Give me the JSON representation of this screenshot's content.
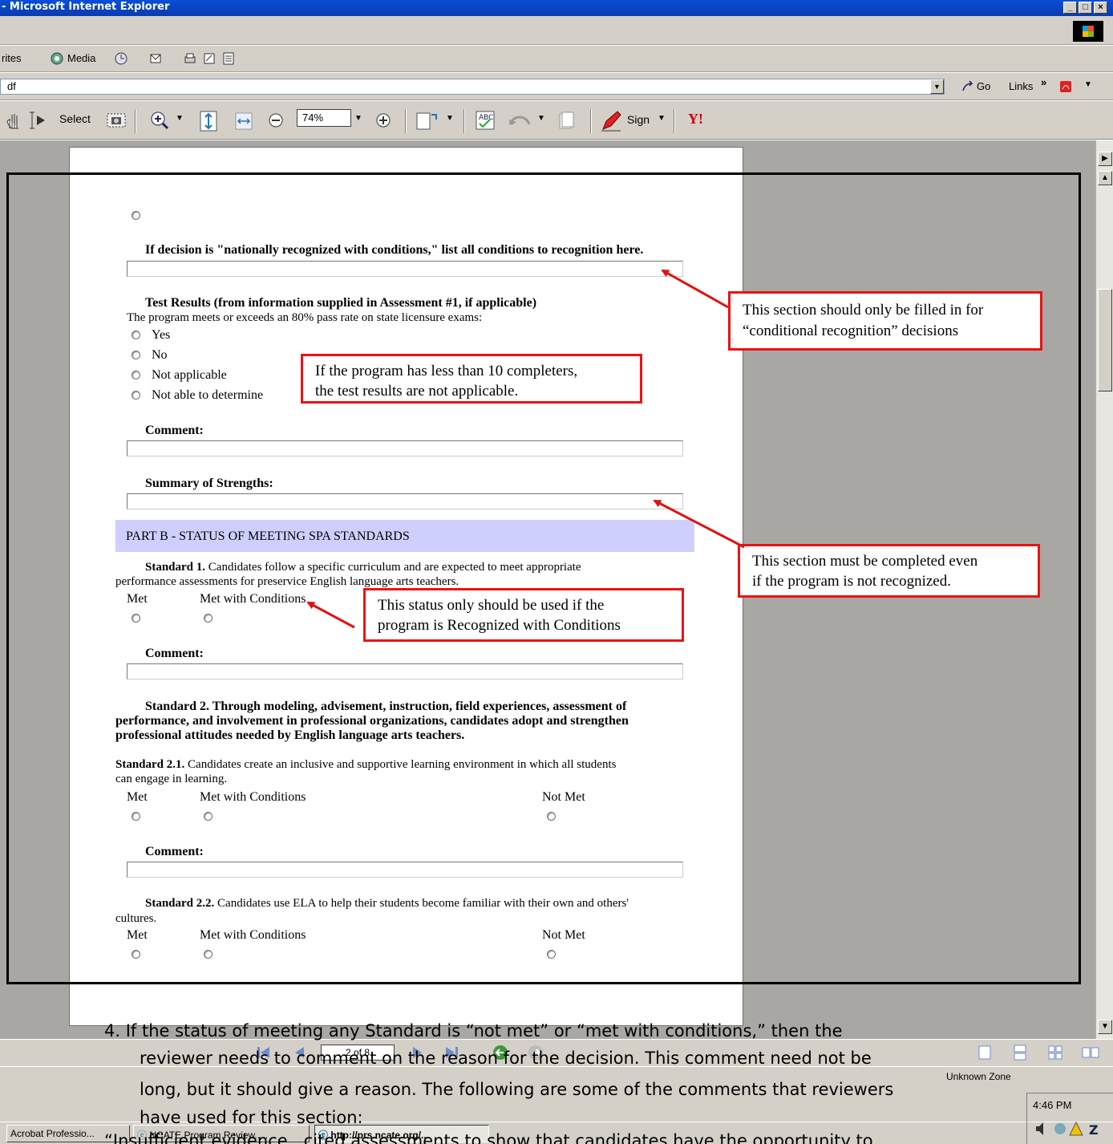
{
  "window": {
    "title": "- Microsoft Internet Explorer",
    "controls": [
      "_",
      "□",
      "×"
    ]
  },
  "ie_toolbar": {
    "favorites": "rites",
    "media": "Media"
  },
  "address": {
    "value": "df",
    "go": "Go",
    "links": "Links"
  },
  "acrobat_toolbar": {
    "select": "Select",
    "zoom": "74%",
    "sign": "Sign"
  },
  "form": {
    "conditions_prompt": "If decision is \"nationally recognized with conditions,\" list all conditions to recognition here.",
    "test_results_heading": "Test Results (from information supplied in Assessment #1, if applicable)",
    "test_results_question": "The program meets or exceeds an 80% pass rate on state licensure exams:",
    "options": [
      "Yes",
      "No",
      "Not applicable",
      "Not able to determine"
    ],
    "comment_label": "Comment:",
    "summary_label": "Summary of Strengths:",
    "part_b_title": "PART B - STATUS OF MEETING SPA STANDARDS",
    "std1_line1_bold": "Standard 1.",
    "std1_line1": "Candidates follow a specific curriculum and are expected to meet appropriate",
    "std1_line2": "performance assessments for preservice English language arts teachers.",
    "met": "Met",
    "met_with_conditions": "Met with Conditions",
    "not_met": "Not Met",
    "std2_line1": "Standard 2. Through modeling, advisement, instruction, field experiences, assessment of",
    "std2_line2": "performance, and involvement in professional organizations, candidates adopt and strengthen",
    "std2_line3": "professional attitudes needed by English language arts teachers.",
    "std21_bold": "Standard 2.1.",
    "std21_line1": "Candidates create an inclusive and supportive learning environment in which all students",
    "std21_line2": "can engage in learning.",
    "std22_bold": "Standard 2.2.",
    "std22_line1": "Candidates use ELA to help their students become familiar with their own and others'",
    "std22_line2": "cultures."
  },
  "callouts": {
    "conditional": [
      "This section should only be filled in for",
      "“conditional recognition” decisions"
    ],
    "test_results": [
      "If the program has less than 10 completers,",
      "the test results are not applicable."
    ],
    "strengths": [
      "This section must be completed even",
      "if the program is not recognized."
    ],
    "met_conditions": [
      "This status only should be used if the",
      "program is Recognized with Conditions"
    ]
  },
  "nav": {
    "page": "2 of 8"
  },
  "status": {
    "zone": "Unknown Zone"
  },
  "taskbar": {
    "items": [
      "Acrobat Professio...",
      "NCATE Program Review.....",
      "http://prs.ncate.org/..."
    ],
    "clock": "4:46 PM"
  },
  "doc_text": {
    "line1": "4.   If the status of meeting any Standard is “not met” or “met with conditions,” then the",
    "line2": "reviewer needs to comment on the reason for the decision.  This comment need not be",
    "line3": "long, but it should give a reason.  The following are some of the comments that reviewers",
    "line4": "have used for this section:",
    "line5": "“Insufficient evidence...cited assessments to show that candidates have the opportunity to"
  },
  "colors": {
    "callout_border": "#e11111",
    "arrow": "#e11111",
    "part_b_band": "#cfcfff",
    "doc_background": "#a8a7a3"
  }
}
